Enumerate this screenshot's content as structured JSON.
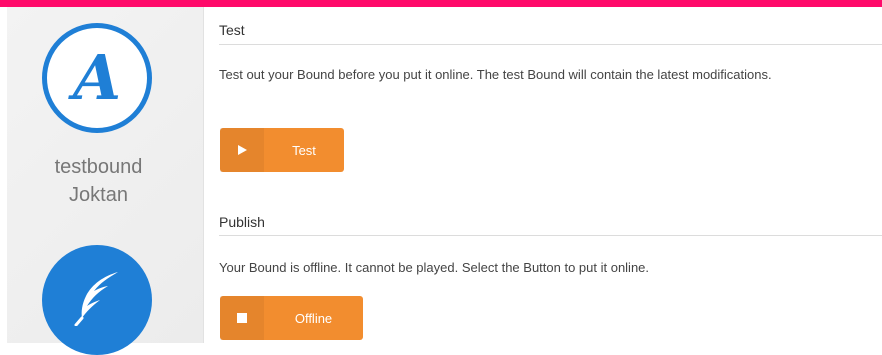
{
  "sidebar": {
    "logo_letter": "A",
    "bound_name": "testbound",
    "owner_name": "Joktan"
  },
  "test": {
    "title": "Test",
    "description": "Test out your Bound before you put it online. The test Bound will contain the latest modifications.",
    "button_label": "Test",
    "button_icon": "play-icon"
  },
  "publish": {
    "title": "Publish",
    "description": "Your Bound is offline. It cannot be played. Select the Button to put it online.",
    "button_label": "Offline",
    "button_icon": "stop-icon"
  },
  "colors": {
    "accent_bar": "#ff0a6a",
    "brand_blue": "#1f7fd6",
    "button_orange": "#f28d2f"
  }
}
